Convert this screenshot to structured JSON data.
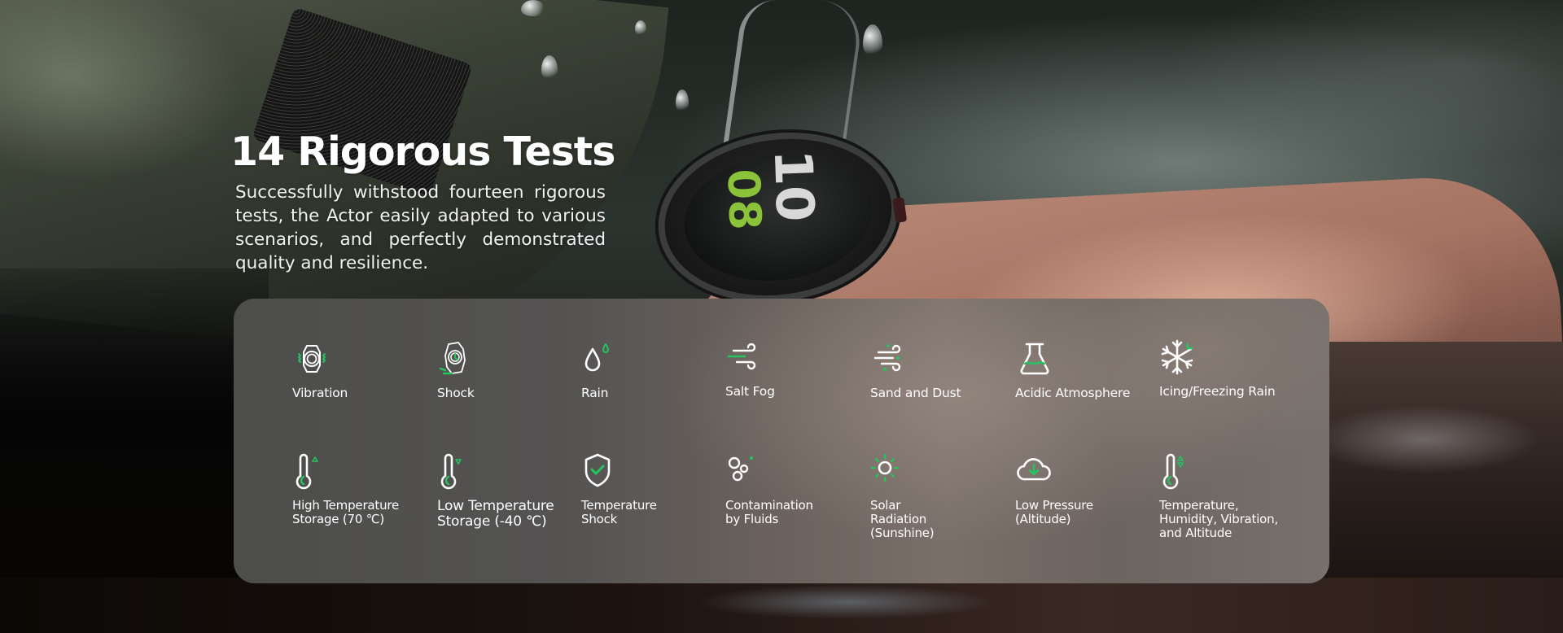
{
  "header": {
    "title": "14 Rigorous Tests",
    "description": "Successfully withstood fourteen rigorous tests, the Actor easily adapted to various scenarios, and perfectly demonstrated quality and resilience."
  },
  "watch": {
    "hour": "08",
    "minute": "10"
  },
  "colors": {
    "accent_green": "#22c55e",
    "icon_white": "#ffffff"
  },
  "tests": [
    {
      "label": "Vibration",
      "icon": "vibrating-watch-icon"
    },
    {
      "label": "Shock",
      "icon": "dropped-watch-icon"
    },
    {
      "label": "Rain",
      "icon": "water-drop-icon"
    },
    {
      "label": "Salt Fog",
      "icon": "wind-icon"
    },
    {
      "label": "Sand and Dust",
      "icon": "wind-dust-icon"
    },
    {
      "label": "Acidic Atmosphere",
      "icon": "flask-icon"
    },
    {
      "label": "Icing/Freezing Rain",
      "icon": "snowflake-icon"
    },
    {
      "label": "High Temperature Storage (70 ℃)",
      "icon": "thermometer-up-icon"
    },
    {
      "label": "Low Temperature Storage (-40 ℃)",
      "icon": "thermometer-down-icon"
    },
    {
      "label": "Temperature Shock",
      "icon": "shield-check-icon"
    },
    {
      "label": "Contamination by Fluids",
      "icon": "bubbles-icon"
    },
    {
      "label": "Solar Radiation (Sunshine)",
      "icon": "sun-icon"
    },
    {
      "label": "Low Pressure (Altitude)",
      "icon": "cloud-down-icon"
    },
    {
      "label": "Temperature, Humidity, Vibration, and Altitude",
      "icon": "thermometer-updown-icon"
    }
  ]
}
